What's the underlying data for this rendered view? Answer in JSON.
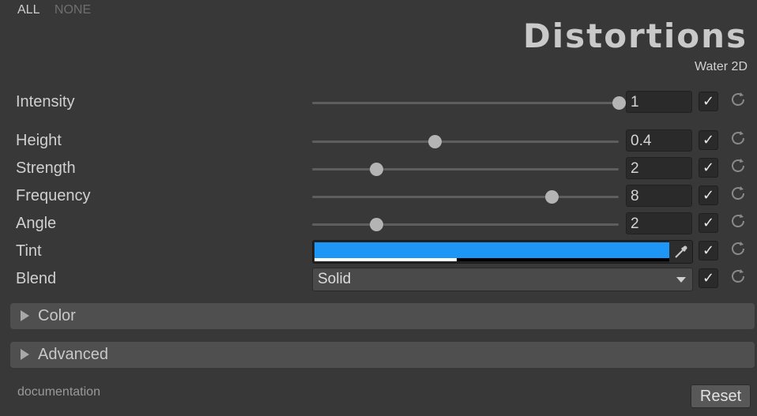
{
  "toplinks": {
    "all": "ALL",
    "none": "NONE"
  },
  "header": {
    "title": "Distortions",
    "subtitle": "Water 2D"
  },
  "rows": {
    "intensity": {
      "label": "Intensity",
      "value": "1",
      "slider_fraction": 1.0,
      "enabled": "✓"
    },
    "height": {
      "label": "Height",
      "value": "0.4",
      "slider_fraction": 0.4,
      "enabled": "✓"
    },
    "strength": {
      "label": "Strength",
      "value": "2",
      "slider_fraction": 0.21,
      "enabled": "✓"
    },
    "frequency": {
      "label": "Frequency",
      "value": "8",
      "slider_fraction": 0.78,
      "enabled": "✓"
    },
    "angle": {
      "label": "Angle",
      "value": "2",
      "slider_fraction": 0.21,
      "enabled": "✓"
    },
    "tint": {
      "label": "Tint",
      "color": "#1e96f5",
      "alpha_fraction": 0.4,
      "enabled": "✓"
    },
    "blend": {
      "label": "Blend",
      "value": "Solid",
      "enabled": "✓"
    }
  },
  "foldouts": {
    "color": "Color",
    "advanced": "Advanced"
  },
  "footer": {
    "documentation": "documentation",
    "reset": "Reset"
  },
  "icons": {
    "reset": "reset-arrow-icon",
    "picker": "eyedropper-icon"
  }
}
